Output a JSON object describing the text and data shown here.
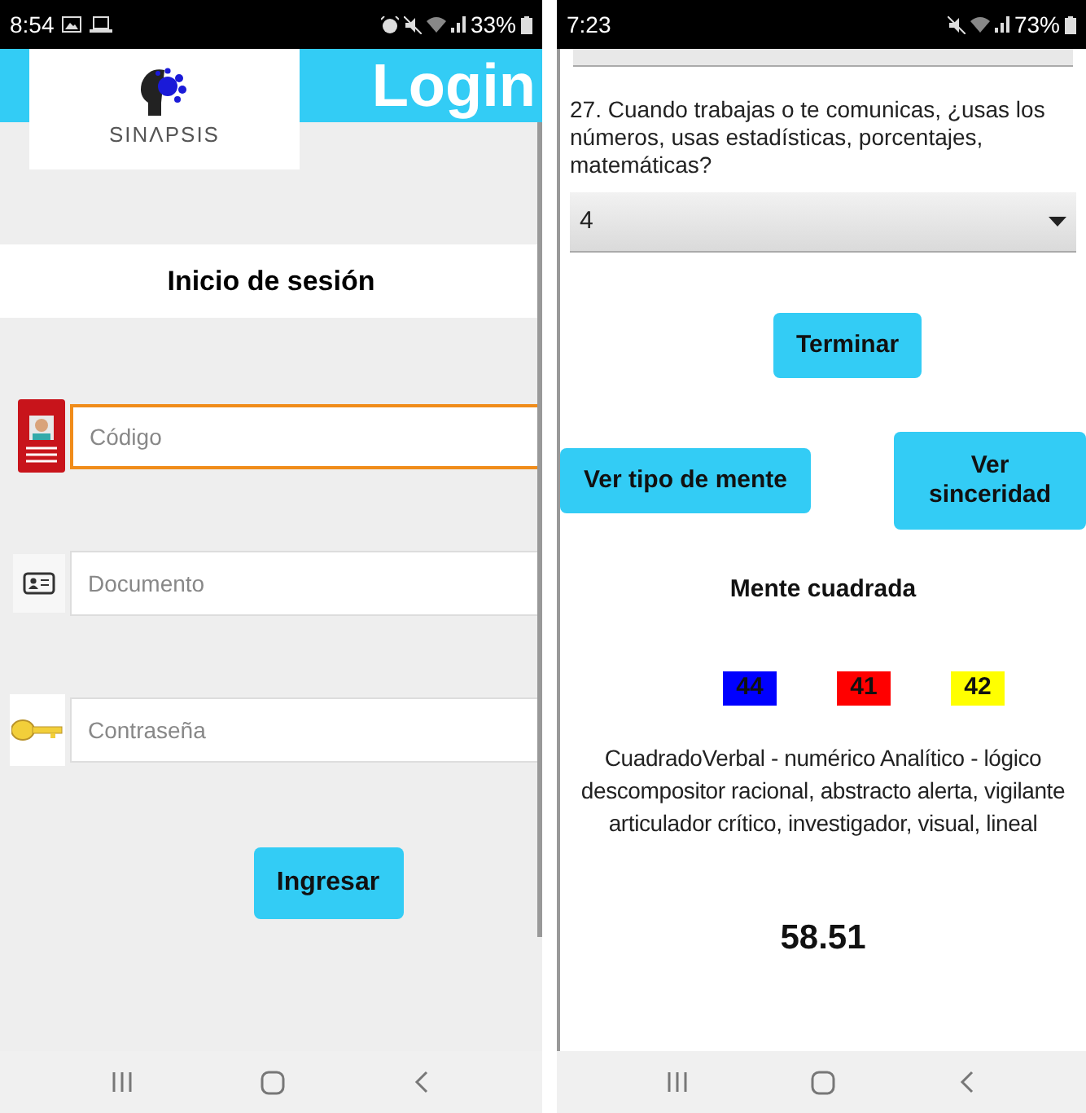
{
  "login_screen": {
    "status_bar": {
      "time": "8:54",
      "battery": "33%"
    },
    "header": {
      "logo_text": "SINΛPSIS",
      "title": "Login"
    },
    "subtitle": "Inicio de sesión",
    "fields": [
      {
        "kind": "badge",
        "placeholder": "Código",
        "focused": true
      },
      {
        "kind": "id-card",
        "placeholder": "Documento",
        "focused": false
      },
      {
        "kind": "key",
        "placeholder": "Contraseña",
        "focused": false
      }
    ],
    "button": "Ingresar"
  },
  "result_screen": {
    "status_bar": {
      "time": "7:23",
      "battery": "73%"
    },
    "question": "27. Cuando trabajas o te comunicas, ¿usas los números, usas estadísticas, porcentajes, matemáticas?",
    "select": {
      "value": "4"
    },
    "finish_button": "Terminar",
    "buttons": [
      "Ver tipo de mente",
      "Ver sinceridad"
    ],
    "heading": "Mente cuadrada",
    "scores": [
      {
        "value": "44",
        "color": "#0000ff"
      },
      {
        "value": "41",
        "color": "#ff0000"
      },
      {
        "value": "42",
        "color": "#ffff00"
      }
    ],
    "description": "CuadradoVerbal - numérico Analítico - lógico descompositor racional, abstracto alerta, vigilante articulador crítico, investigador, visual, lineal",
    "total": "58.51"
  }
}
